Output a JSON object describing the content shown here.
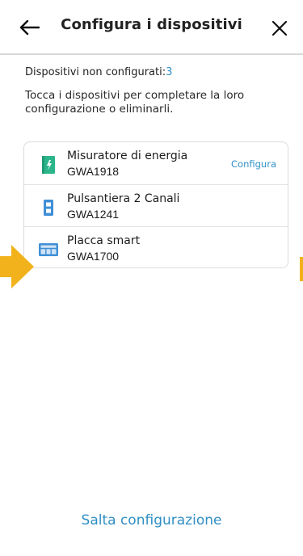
{
  "header": {
    "title": "Configura i dispositivi",
    "back_icon": "arrow-left-icon",
    "close_icon": "close-icon"
  },
  "summary": {
    "label": "Dispositivi non configurati:",
    "count": "3"
  },
  "info_text": "Tocca i dispositivi per completare la loro configurazione o eliminarli.",
  "devices": [
    {
      "name": "Misuratore di energia",
      "code": "GWA1918",
      "icon": "energy-meter-icon",
      "action": "Configura"
    },
    {
      "name": "Pulsantiera 2 Canali",
      "code": "GWA1241",
      "icon": "switch-panel-icon"
    },
    {
      "name": "Placca smart",
      "code": "GWA1700",
      "icon": "smart-plate-icon"
    }
  ],
  "skip_label": "Salta configurazione",
  "colors": {
    "accent": "#2f90c8",
    "overlay_arrow": "#f2b21c",
    "meter_green": "#2cb58a",
    "device_blue": "#3f8fd6"
  }
}
